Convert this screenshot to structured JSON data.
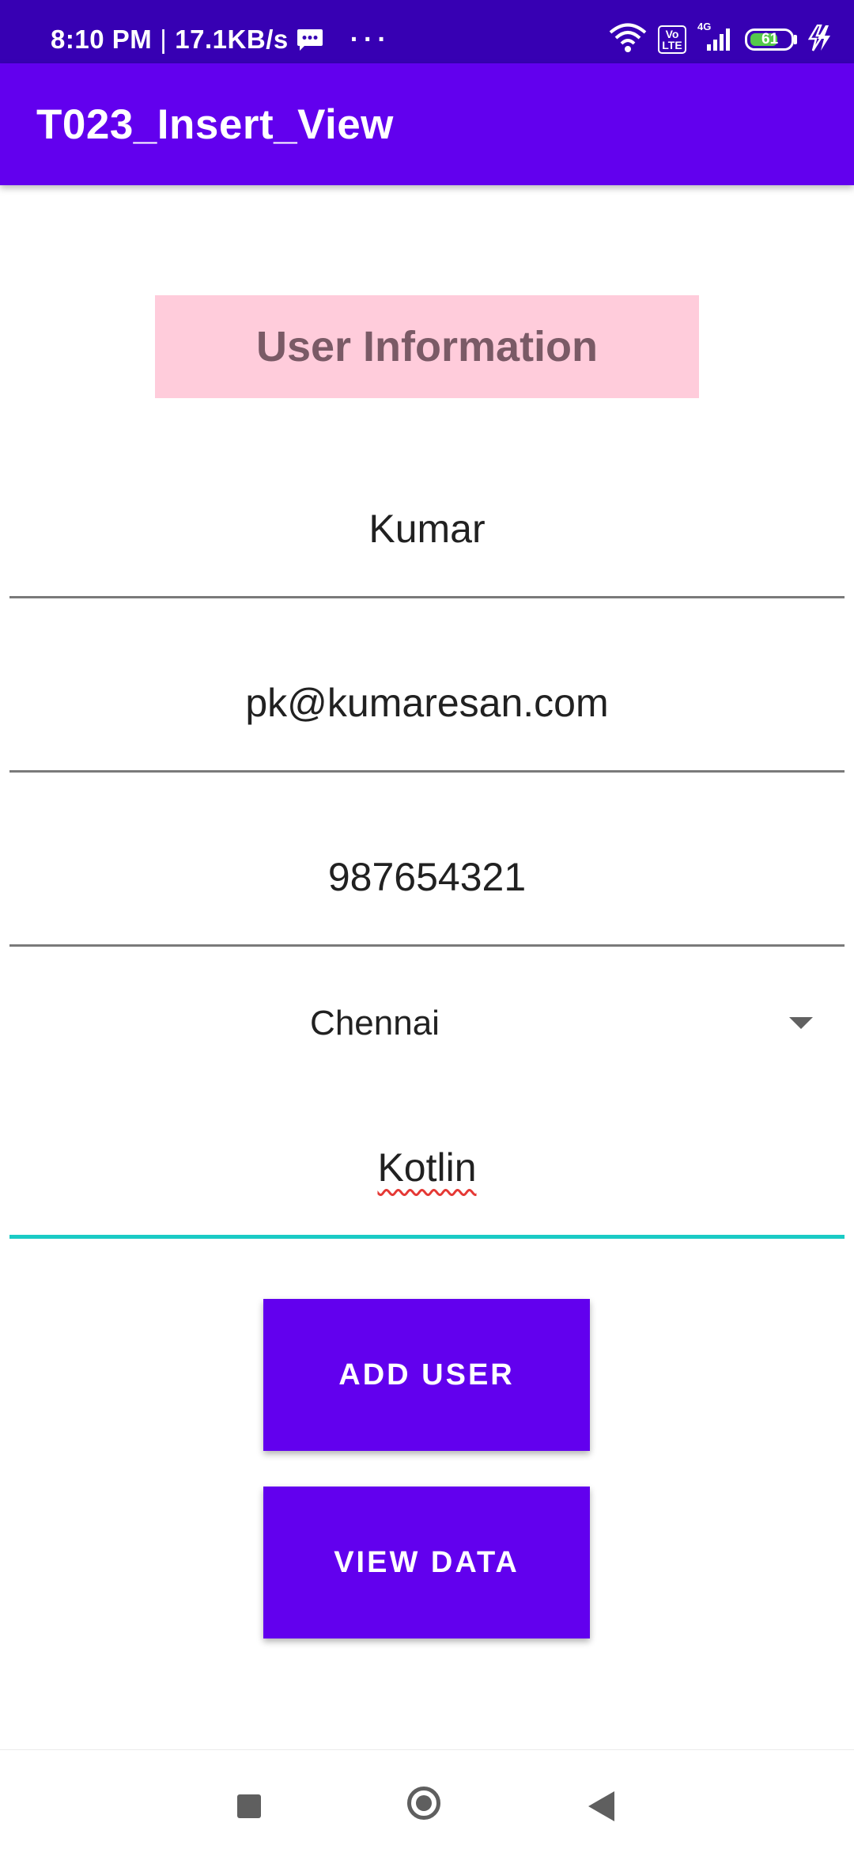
{
  "status_bar": {
    "time": "8:10 PM",
    "speed": "17.1KB/s",
    "more": "···",
    "volte_label": "Vo LTE",
    "network": "4G",
    "battery_level": "61"
  },
  "app_bar": {
    "title": "T023_Insert_View"
  },
  "form": {
    "header": "User Information",
    "name_value": "Kumar",
    "email_value": "pk@kumaresan.com",
    "phone_value": "987654321",
    "city_selected": "Chennai",
    "course_value": "Kotlin"
  },
  "buttons": {
    "add_user": "ADD USER",
    "view_data": "VIEW DATA"
  },
  "colors": {
    "status_bar": "#3700B3",
    "primary": "#6200EE",
    "header_bg": "#FFCCDB",
    "focus_line": "#1ACBC5"
  }
}
